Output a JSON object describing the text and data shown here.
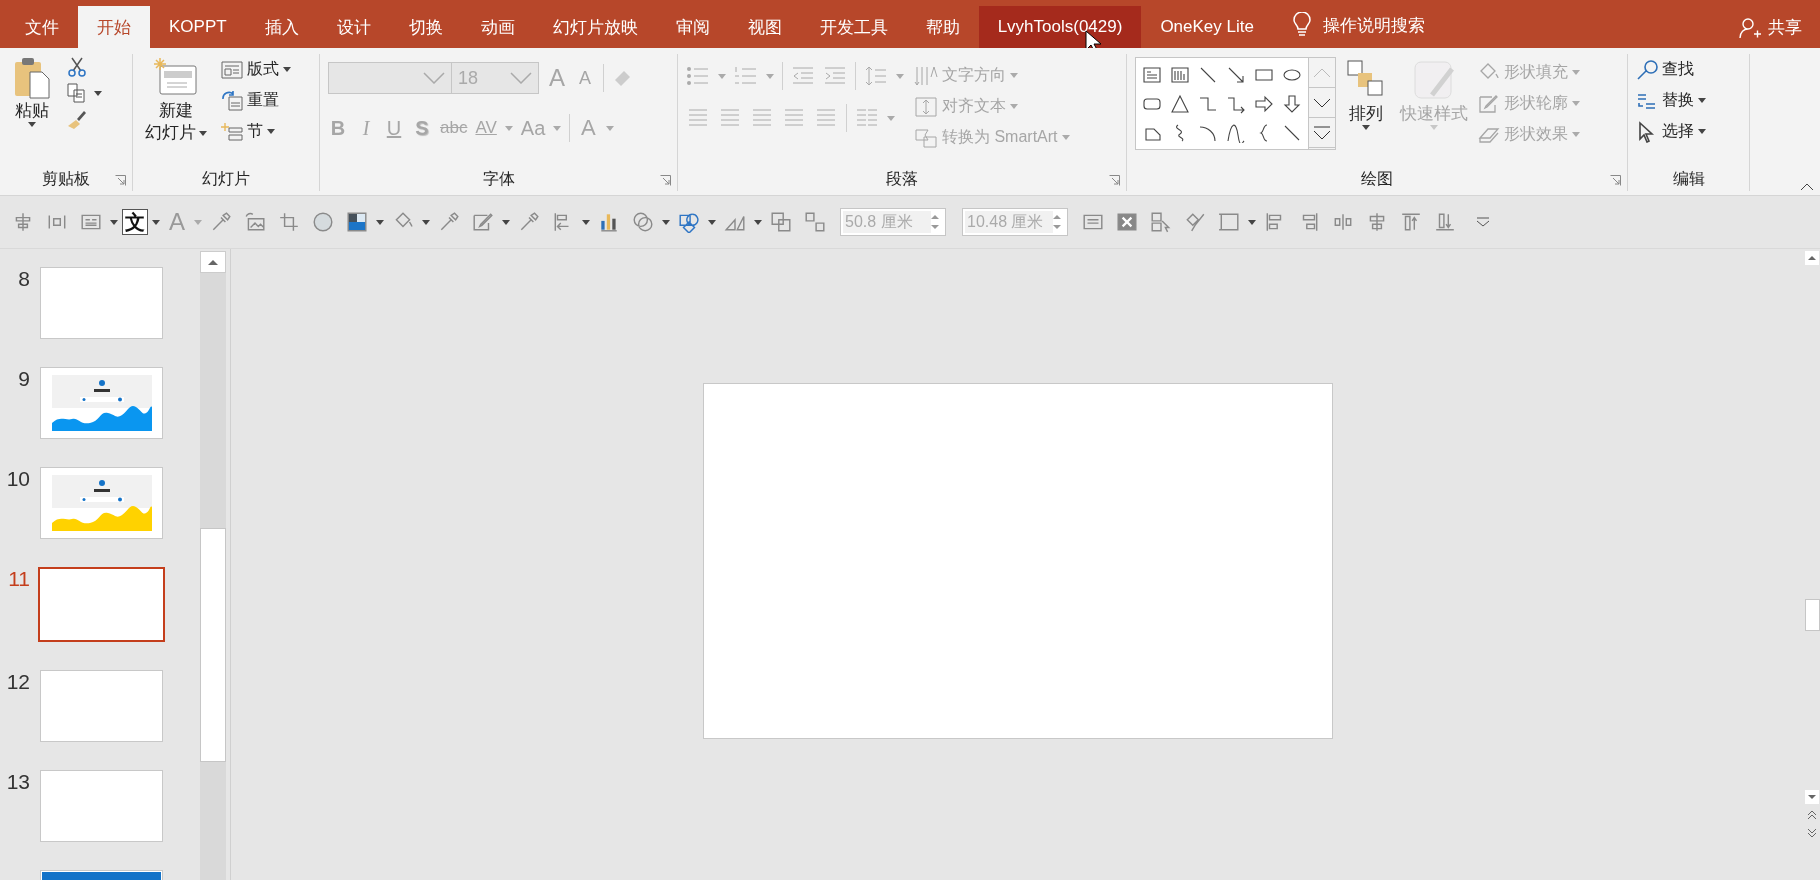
{
  "tabs": [
    {
      "label": "文件",
      "selected": false,
      "hovered": false
    },
    {
      "label": "开始",
      "selected": true,
      "hovered": false
    },
    {
      "label": "KOPPT",
      "selected": false,
      "hovered": false
    },
    {
      "label": "插入",
      "selected": false,
      "hovered": false
    },
    {
      "label": "设计",
      "selected": false,
      "hovered": false
    },
    {
      "label": "切换",
      "selected": false,
      "hovered": false
    },
    {
      "label": "动画",
      "selected": false,
      "hovered": false
    },
    {
      "label": "幻灯片放映",
      "selected": false,
      "hovered": false
    },
    {
      "label": "审阅",
      "selected": false,
      "hovered": false
    },
    {
      "label": "视图",
      "selected": false,
      "hovered": false
    },
    {
      "label": "开发工具",
      "selected": false,
      "hovered": false
    },
    {
      "label": "帮助",
      "selected": false,
      "hovered": false
    },
    {
      "label": "LvyhTools(0429)",
      "selected": false,
      "hovered": true
    },
    {
      "label": "OneKey Lite",
      "selected": false,
      "hovered": false
    }
  ],
  "search": {
    "placeholder": "操作说明搜索"
  },
  "share": {
    "label": "共享"
  },
  "ribbon": {
    "groups": [
      {
        "label": "剪贴板",
        "launcher": true,
        "commands": [
          {
            "lines": [
              "粘贴"
            ],
            "disabled": false
          }
        ]
      },
      {
        "label": "幻灯片",
        "launcher": false,
        "commands": [
          {
            "lines": [
              "新建",
              "幻灯片"
            ],
            "disabled": false
          },
          {
            "lines": [
              "版式"
            ],
            "disabled": false
          },
          {
            "lines": [
              "重置"
            ],
            "disabled": false
          },
          {
            "lines": [
              "节"
            ],
            "disabled": false
          }
        ]
      },
      {
        "label": "字体",
        "launcher": true,
        "font_name": {
          "disabled": true
        },
        "font_size": {
          "value": "18",
          "disabled": true
        },
        "format_buttons": [
          {
            "label": "A",
            "kind": "grow",
            "disabled": true
          },
          {
            "label": "A",
            "kind": "shrink",
            "disabled": true
          },
          {
            "label": "B",
            "kind": "bold",
            "disabled": true
          },
          {
            "label": "I",
            "kind": "italic",
            "disabled": true
          },
          {
            "label": "U",
            "kind": "underline",
            "disabled": true
          },
          {
            "label": "S",
            "kind": "shadow",
            "disabled": true
          },
          {
            "label": "abc",
            "kind": "strike",
            "disabled": true
          },
          {
            "label": "AV",
            "kind": "spacing",
            "disabled": true
          },
          {
            "label": "Aa",
            "kind": "case",
            "disabled": true
          },
          {
            "label": "A",
            "kind": "color",
            "disabled": true
          }
        ]
      },
      {
        "label": "段落",
        "launcher": true,
        "commands": [
          {
            "lines": [
              "文字方向"
            ],
            "disabled": true
          },
          {
            "lines": [
              "对齐文本"
            ],
            "disabled": true
          },
          {
            "lines": [
              "转换为 SmartArt"
            ],
            "disabled": true
          }
        ]
      },
      {
        "label": "绘图",
        "launcher": true,
        "commands": [
          {
            "lines": [
              "排列"
            ],
            "disabled": false
          },
          {
            "lines": [
              "快速样式"
            ],
            "disabled": true
          },
          {
            "lines": [
              "形状填充"
            ],
            "disabled": true
          },
          {
            "lines": [
              "形状轮廓"
            ],
            "disabled": true
          },
          {
            "lines": [
              "形状效果"
            ],
            "disabled": true
          }
        ]
      },
      {
        "label": "编辑",
        "launcher": false,
        "commands": [
          {
            "lines": [
              "查找"
            ],
            "disabled": false
          },
          {
            "lines": [
              "替换"
            ],
            "disabled": false
          },
          {
            "lines": [
              "选择"
            ],
            "disabled": false
          }
        ]
      }
    ]
  },
  "toolbar": {
    "glyphs": [
      {
        "label": "文",
        "disabled": false
      },
      {
        "label": "A",
        "disabled": true
      }
    ],
    "fields": [
      {
        "value": "50.8 厘米",
        "disabled": true
      },
      {
        "value": "10.48 厘米",
        "disabled": true
      }
    ]
  },
  "slides": [
    {
      "number": "8",
      "selected": false,
      "kind": "blank"
    },
    {
      "number": "9",
      "selected": false,
      "kind": "wave",
      "color": "#0a96f0"
    },
    {
      "number": "10",
      "selected": false,
      "kind": "wave",
      "color": "#ffd200"
    },
    {
      "number": "11",
      "selected": true,
      "kind": "blank"
    },
    {
      "number": "12",
      "selected": false,
      "kind": "blank"
    },
    {
      "number": "13",
      "selected": false,
      "kind": "blank"
    },
    {
      "selected": false,
      "kind": "banner",
      "color": "#1473c8"
    }
  ]
}
